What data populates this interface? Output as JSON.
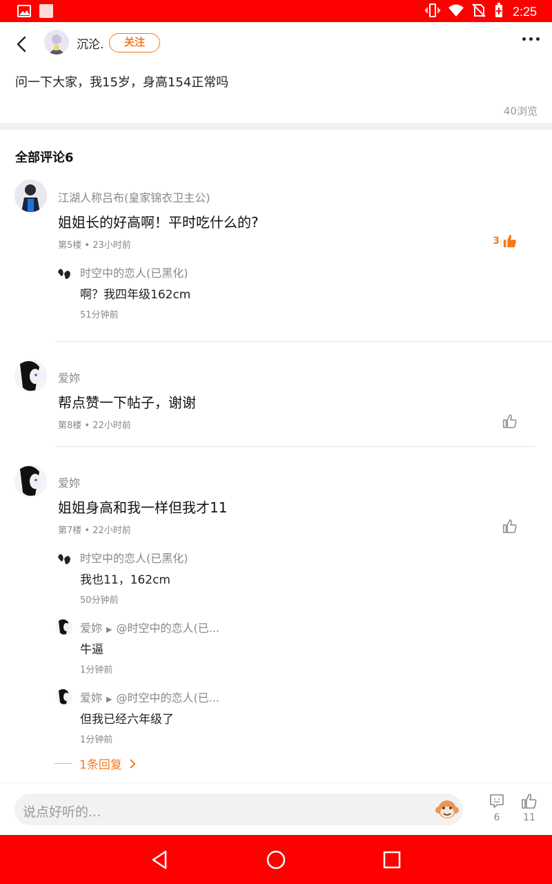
{
  "status_bar": {
    "time": "2:25",
    "icons": [
      "image-icon",
      "app-icon",
      "vibrate-icon",
      "wifi-icon",
      "no-sim-icon",
      "battery-icon"
    ]
  },
  "header": {
    "host_name": "沉沦.",
    "follow_label": "关注"
  },
  "post": {
    "text": "问一下大家，我15岁，身高154正常吗",
    "views": "40浏览"
  },
  "comments_title": "全部评论6",
  "comments": [
    {
      "name": "江湖人称吕布(皇家锦衣卫主公)",
      "text": "姐姐长的好高啊！平时吃什么的?",
      "meta": "第5楼 • 23小时前",
      "likes": "3",
      "replies": [
        {
          "name": "时空中的恋人(已黑化)",
          "text": "啊？我四年级162cm",
          "time": "51分钟前"
        }
      ]
    },
    {
      "name": "爱妳",
      "text": "帮点赞一下帖子，谢谢",
      "meta": "第8楼 • 22小时前",
      "likes": ""
    },
    {
      "name": "爱妳",
      "text": "姐姐身高和我一样但我才11",
      "meta": "第7楼 • 22小时前",
      "likes": "",
      "replies": [
        {
          "name": "时空中的恋人(已黑化)",
          "text": "我也11，162cm",
          "time": "50分钟前"
        },
        {
          "name": "爱妳",
          "target": "@时空中的恋人(已...",
          "text": "牛逼",
          "time": "1分钟前"
        },
        {
          "name": "爱妳",
          "target": "@时空中的恋人(已...",
          "text": "但我已经六年级了",
          "time": "1分钟前"
        }
      ],
      "more_replies": "1条回复"
    }
  ],
  "bottom_bar": {
    "placeholder": "说点好听的...",
    "comment_count": "6",
    "like_count": "11"
  },
  "colors": {
    "status_bar": "#ff0000",
    "accent": "#f57a1c",
    "nav_bar": "#ff0000"
  }
}
